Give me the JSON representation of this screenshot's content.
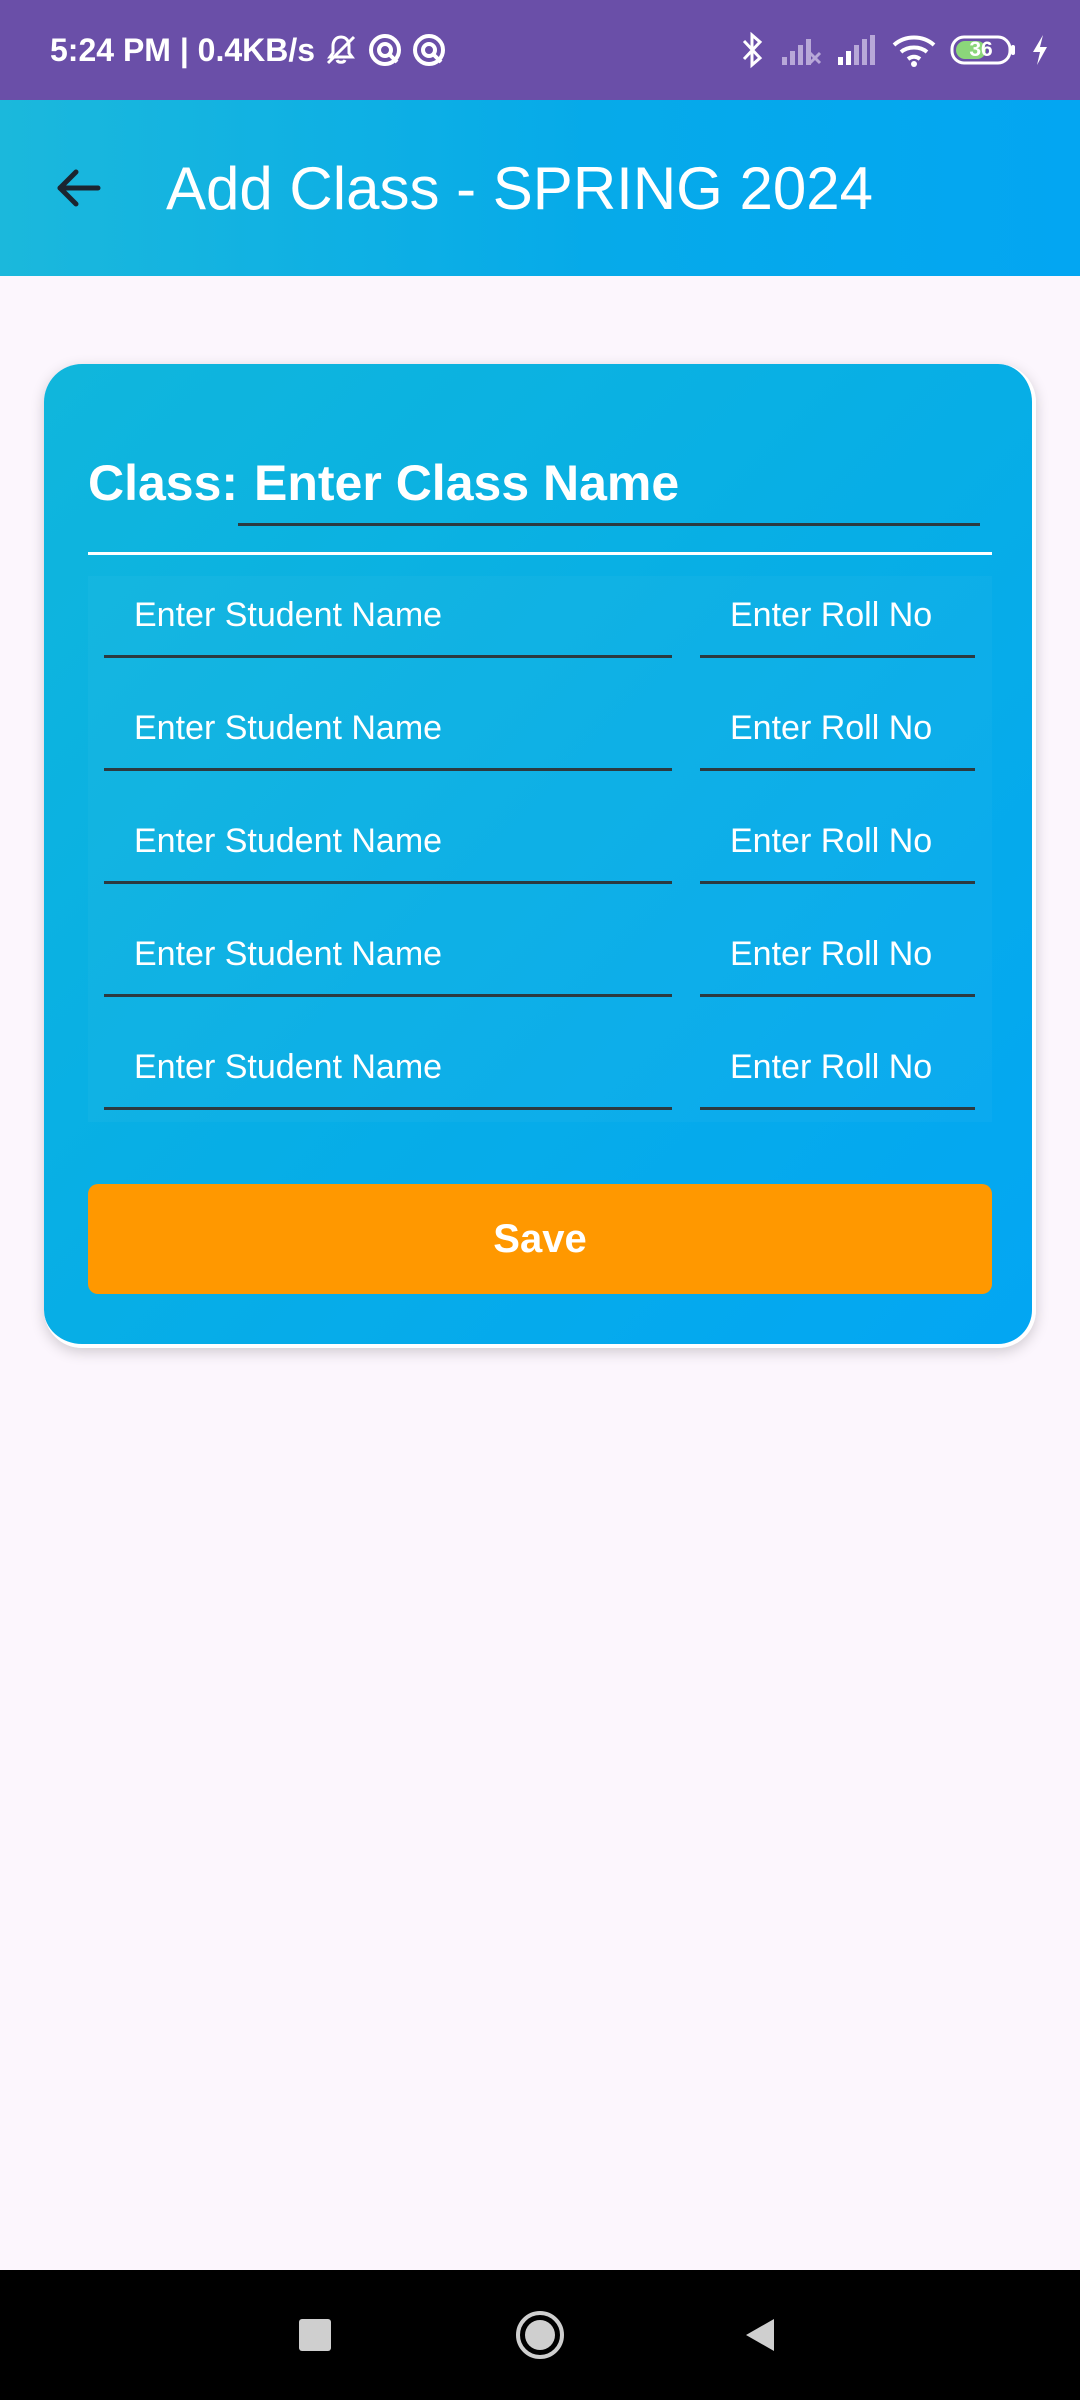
{
  "status_bar": {
    "time_and_speed": "5:24 PM | 0.4KB/s",
    "battery_level": "36",
    "icons": [
      "mute-notifications-icon",
      "app-notification-icon",
      "app-notification-icon",
      "bluetooth-icon",
      "signal-empty-icon",
      "signal-icon",
      "wifi-icon",
      "battery-icon",
      "charging-icon"
    ]
  },
  "app_bar": {
    "title": "Add Class - SPRING 2024",
    "back_icon": "arrow-left-icon",
    "background_start": "#1bb8dc",
    "background_end": "#03a6f2"
  },
  "form": {
    "class_label": "Class:",
    "class_placeholder": "Enter Class Name",
    "students": [
      {
        "name_placeholder": "Enter Student Name",
        "roll_placeholder": "Enter Roll No"
      },
      {
        "name_placeholder": "Enter Student Name",
        "roll_placeholder": "Enter Roll No"
      },
      {
        "name_placeholder": "Enter Student Name",
        "roll_placeholder": "Enter Roll No"
      },
      {
        "name_placeholder": "Enter Student Name",
        "roll_placeholder": "Enter Roll No"
      },
      {
        "name_placeholder": "Enter Student Name",
        "roll_placeholder": "Enter Roll No"
      }
    ],
    "save_label": "Save",
    "save_color": "#ff9800"
  },
  "nav_bar": {
    "icons": [
      "recents-square-icon",
      "home-circle-icon",
      "back-triangle-icon"
    ]
  }
}
